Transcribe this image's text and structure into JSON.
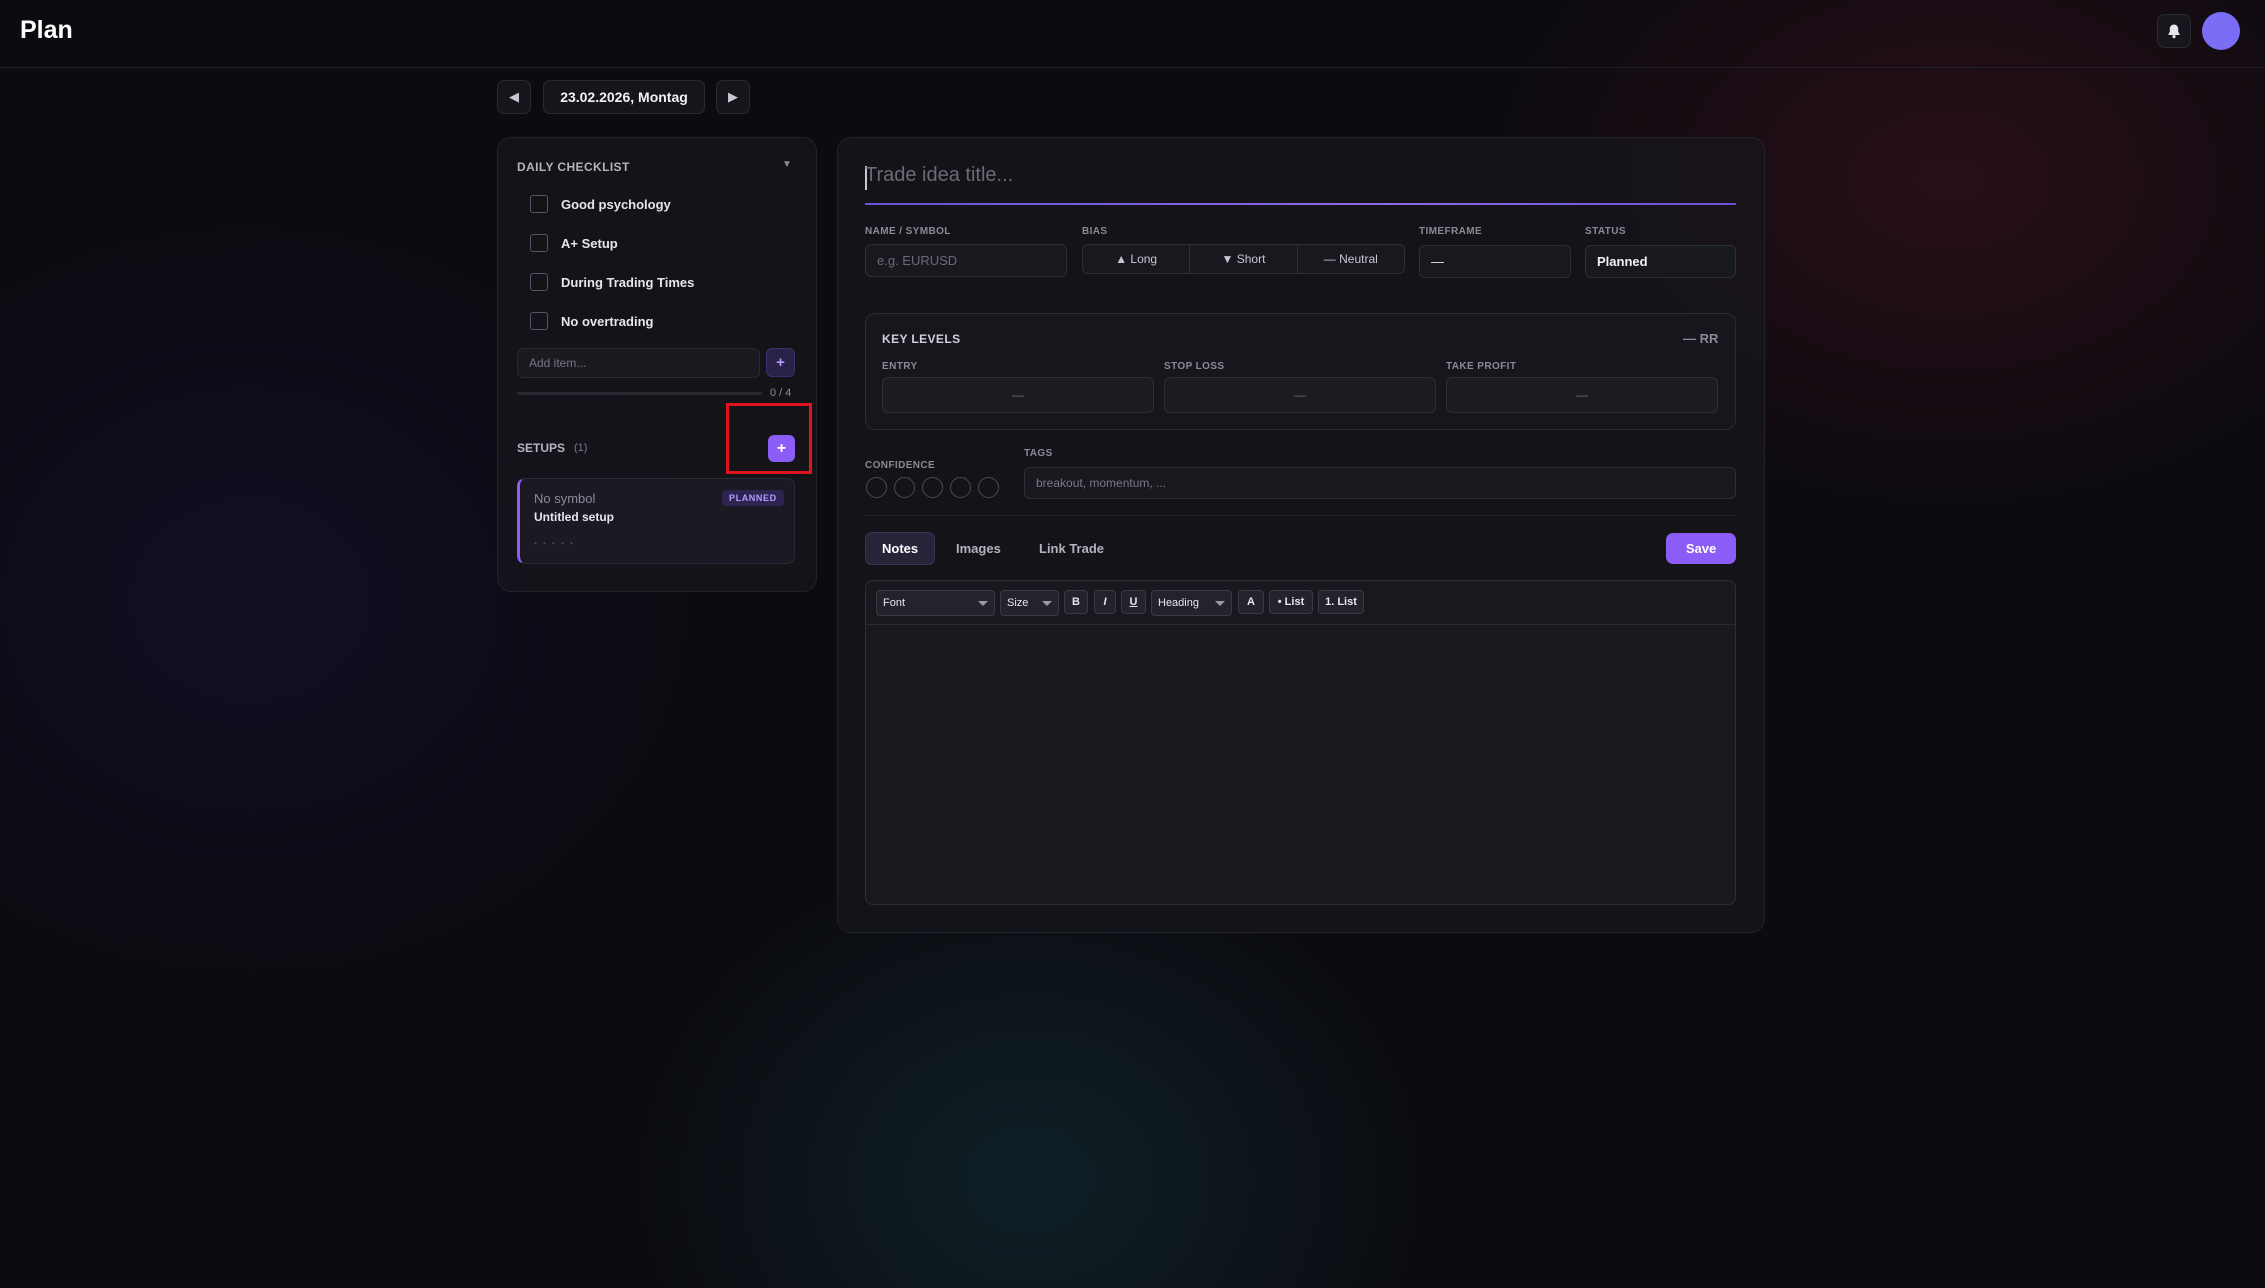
{
  "app": {
    "title": "Plan"
  },
  "date_nav": {
    "prev": "◀",
    "date": "23.02.2026, Montag",
    "next": "▶"
  },
  "checklist": {
    "title": "DAILY CHECKLIST",
    "toggle": "▼",
    "items": [
      {
        "label": "Good psychology",
        "checked": false
      },
      {
        "label": "A+ Setup",
        "checked": false
      },
      {
        "label": "During Trading Times",
        "checked": false
      },
      {
        "label": "No overtrading",
        "checked": false
      }
    ],
    "add_placeholder": "Add item...",
    "add_button": "+",
    "progress": {
      "done": 0,
      "total": 4,
      "text": "0 / 4"
    }
  },
  "setups": {
    "title": "SETUPS",
    "count": "(1)",
    "add_button": "+",
    "cards": [
      {
        "symbol": "No symbol",
        "title": "Untitled setup",
        "status": "PLANNED",
        "rating": "• • • • •"
      }
    ]
  },
  "form": {
    "title_placeholder": "Trade idea title...",
    "name_label": "NAME / SYMBOL",
    "name_placeholder": "e.g. EURUSD",
    "bias_label": "BIAS",
    "bias_options": [
      "▲ Long",
      "▼ Short",
      "— Neutral"
    ],
    "timeframe_label": "TIMEFRAME",
    "timeframe_value": "—",
    "status_label": "STATUS",
    "status_value": "Planned",
    "key_levels": {
      "title": "KEY LEVELS",
      "rr": "— RR",
      "entry_label": "ENTRY",
      "stop_label": "STOP LOSS",
      "tp_label": "TAKE PROFIT",
      "entry_value": "—",
      "stop_value": "—",
      "tp_value": "—"
    },
    "confidence_label": "CONFIDENCE",
    "confidence_level": 0,
    "tags_label": "TAGS",
    "tags_placeholder": "breakout, momentum, ..."
  },
  "tabs": [
    "Notes",
    "Images",
    "Link Trade"
  ],
  "save_label": "Save",
  "editor_toolbar": {
    "font": "Font",
    "size": "Size",
    "bold": "B",
    "italic": "I",
    "underline": "U",
    "heading": "Heading",
    "color": "A",
    "bullet_list": "• List",
    "numbered_list": "1. List"
  },
  "colors": {
    "accent": "#8b5cf6",
    "avatar": "#7b6ef6",
    "highlight": "#e0141e"
  }
}
